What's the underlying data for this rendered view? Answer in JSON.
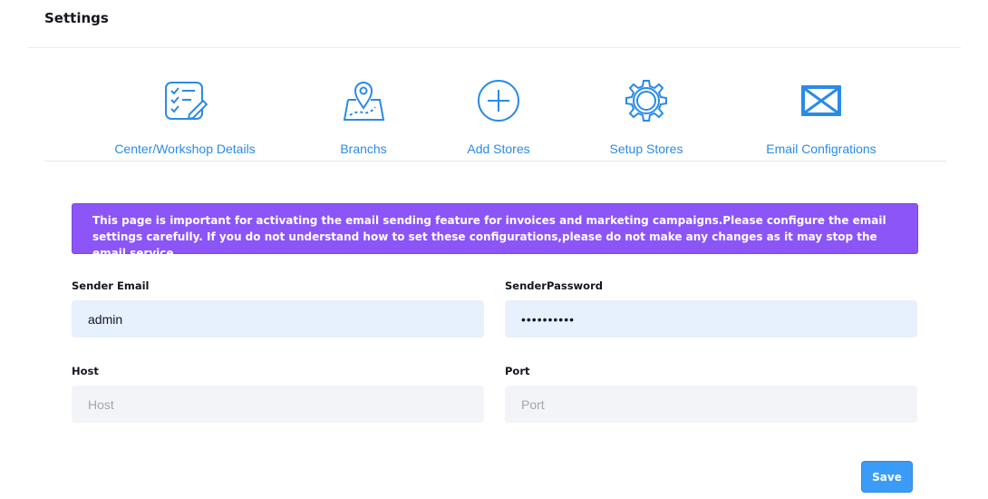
{
  "page": {
    "title": "Settings"
  },
  "nav": {
    "items": [
      {
        "label": "Center/Workshop Details",
        "icon": "checklist-icon"
      },
      {
        "label": "Branchs",
        "icon": "map-pin-icon"
      },
      {
        "label": "Add Stores",
        "icon": "add-circle-icon"
      },
      {
        "label": "Setup Stores",
        "icon": "gear-icon"
      },
      {
        "label": "Email Configrations",
        "icon": "envelope-icon"
      }
    ]
  },
  "alert": {
    "text": "This page is important for activating the email sending feature for invoices and marketing campaigns.Please configure the email settings carefully. If you do not understand how to set these configurations,please do not make any changes as it may stop the email service"
  },
  "form": {
    "sender_email": {
      "label": "Sender Email",
      "value": "admin",
      "placeholder": ""
    },
    "sender_password": {
      "label": "SenderPassword",
      "value": "••••••••••",
      "placeholder": ""
    },
    "host": {
      "label": "Host",
      "value": "",
      "placeholder": "Host"
    },
    "port": {
      "label": "Port",
      "value": "",
      "placeholder": "Port"
    }
  },
  "actions": {
    "save_label": "Save"
  },
  "colors": {
    "accent": "#2a8be6",
    "alert_bg": "#8b55f7",
    "input_filled": "#e7f0fd",
    "input_empty": "#f3f4f7",
    "save_bg": "#3b9cf7"
  }
}
